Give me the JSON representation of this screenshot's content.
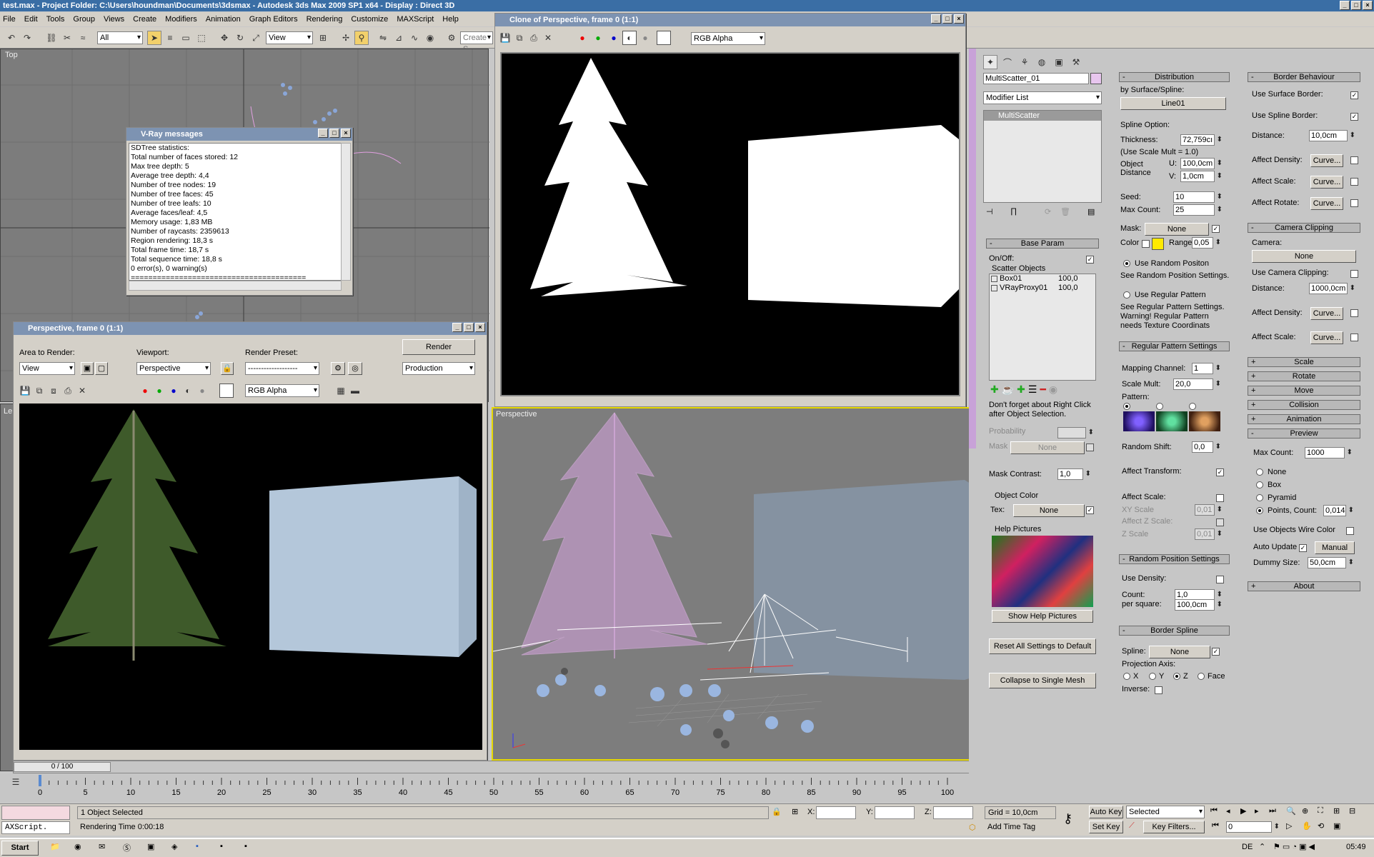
{
  "window": {
    "title": "test.max    - Project Folder: C:\\Users\\houndman\\Documents\\3dsmax    - Autodesk 3ds Max  2009 SP1  x64     - Display : Direct 3D"
  },
  "menu": [
    "File",
    "Edit",
    "Tools",
    "Group",
    "Views",
    "Create",
    "Modifiers",
    "Animation",
    "Graph Editors",
    "Rendering",
    "Customize",
    "MAXScript",
    "Help"
  ],
  "toolbar": {
    "selection_filter": "All",
    "ref_coord": "View",
    "create_sel": "Create S"
  },
  "top_viewport": {
    "label": "Top"
  },
  "vray_messages": {
    "title": "V-Ray messages",
    "lines": [
      "SDTree statistics:",
      "Total number of faces stored: 12",
      "Max tree depth: 5",
      "Average tree depth: 4,4",
      "Number of tree nodes: 19",
      "Number of tree faces: 45",
      "Number of tree leafs: 10",
      "Average faces/leaf: 4,5",
      "Memory usage: 1,83 MB",
      "Number of raycasts: 2359613",
      "Region rendering: 18,3 s",
      "Total frame time: 18,7 s",
      "Total sequence time: 18,8 s",
      "0 error(s), 0 warning(s)",
      "========================================"
    ]
  },
  "render_frame": {
    "title": "Perspective, frame 0 (1:1)",
    "area_label": "Area to Render:",
    "area_value": "View",
    "viewport_label": "Viewport:",
    "viewport_value": "Perspective",
    "preset_label": "Render Preset:",
    "preset_value": "-------------------",
    "render_btn": "Render",
    "production": "Production",
    "channel": "RGB Alpha"
  },
  "clone_frame": {
    "title": "Clone of Perspective, frame 0 (1:1)",
    "channel": "RGB Alpha"
  },
  "persp_viewport": {
    "label": "Perspective"
  },
  "left_viewport": {
    "label": "Le"
  },
  "cmd_panel": {
    "object_name": "MultiScatter_01",
    "modifier_list": "Modifier List",
    "stack_item": "MultiScatter",
    "base_param": "Base Param",
    "onoff": "On/Off:",
    "scatter_objects": "Scatter Objects",
    "scatter_list": [
      {
        "name": "Box01",
        "val": "100,0"
      },
      {
        "name": "VRayProxy01",
        "val": "100,0"
      }
    ],
    "hint": "Don't forget about Right Click after Object Selection.",
    "probability": "Probability",
    "mask": "Mask",
    "mask_none": "None",
    "mask_contrast": "Mask Contrast:",
    "mask_contrast_val": "1,0",
    "object_color": "Object Color",
    "tex": "Tex:",
    "tex_none": "None",
    "help_pictures": "Help Pictures",
    "show_help": "Show Help Pictures",
    "reset": "Reset All Settings to Default",
    "collapse": "Collapse to Single Mesh"
  },
  "distribution": {
    "title": "Distribution",
    "by_surface": "by Surface/Spline:",
    "line": "Line01",
    "spline_option": "Spline Option:",
    "thickness": "Thickness:",
    "thickness_val": "72,759cı",
    "use_scale": "(Use Scale Mult = 1.0)",
    "object_distance": "Object Distance",
    "u": "U:",
    "u_val": "100,0cm",
    "v": "V:",
    "v_val": "1,0cm",
    "seed": "Seed:",
    "seed_val": "10",
    "max_count": "Max Count:",
    "max_count_val": "25",
    "mask": "Mask:",
    "mask_val": "None",
    "color": "Color",
    "range": "Range",
    "range_val": "0,05",
    "use_random": "Use Random Positon",
    "see_random": "See Random Position Settings.",
    "use_regular": "Use Regular Pattern",
    "see_regular": "See Regular Pattern Settings. Warning! Regular Pattern needs Texture Coordinats",
    "regular_title": "Regular Pattern Settings",
    "mapping": "Mapping Channel:",
    "mapping_val": "1",
    "scale_mult": "Scale Mult:",
    "scale_mult_val": "20,0",
    "pattern": "Pattern:",
    "random_shift": "Random Shift:",
    "random_shift_val": "0,0",
    "affect_transform": "Affect Transform:",
    "affect_scale": "Affect Scale:",
    "xy_scale": "XY Scale",
    "xy_val": "0,01",
    "affect_z": "Affect Z Scale:",
    "z_scale": "Z Scale",
    "z_val": "0,01",
    "random_pos_title": "Random Position Settings",
    "use_density": "Use Density:",
    "count": "Count:",
    "count_val": "1,0",
    "per_square": "per square:",
    "per_square_val": "100,0cm",
    "border_spline": "Border Spline",
    "spline": "Spline:",
    "spline_val": "None",
    "proj_axis": "Projection Axis:",
    "x": "X",
    "y": "Y",
    "z": "Z",
    "face": "Face",
    "inverse": "Inverse:"
  },
  "border": {
    "title": "Border Behaviour",
    "use_surface": "Use Surface Border:",
    "use_spline": "Use Spline Border:",
    "distance": "Distance:",
    "distance_val": "10,0cm",
    "affect_density": "Affect Density:",
    "affect_scale": "Affect Scale:",
    "affect_rotate": "Affect Rotate:",
    "curve": "Curve...",
    "camera_clipping": "Camera Clipping",
    "camera": "Camera:",
    "camera_val": "None",
    "use_cam": "Use Camera Clipping:",
    "cam_distance": "Distance:",
    "cam_distance_val": "1000,0cm",
    "scale": "Scale",
    "rotate": "Rotate",
    "move": "Move",
    "collision": "Collision",
    "animation": "Animation",
    "preview": "Preview",
    "max_count": "Max Count:",
    "max_count_val": "1000",
    "none": "None",
    "box": "Box",
    "pyramid": "Pyramid",
    "points": "Points,  Count:",
    "points_val": "0,014",
    "wire_color": "Use Objects Wire Color",
    "auto_update": "Auto Update",
    "manual": "Manual",
    "dummy": "Dummy Size:",
    "dummy_val": "50,0cm",
    "about": "About"
  },
  "timeline": {
    "frame": "0 / 100",
    "ticks": [
      "0",
      "5",
      "10",
      "15",
      "20",
      "25",
      "30",
      "35",
      "40",
      "45",
      "50",
      "55",
      "60",
      "65",
      "70",
      "75",
      "80",
      "85",
      "90",
      "95",
      "100"
    ]
  },
  "status": {
    "listener": "AXScript.",
    "selected": "1 Object Selected",
    "render_time": "Rendering Time  0:00:18",
    "x": "X:",
    "y": "Y:",
    "z": "Z:",
    "grid": "Grid = 10,0cm",
    "add_tag": "Add Time Tag",
    "auto_key": "Auto Key",
    "set_key": "Set Key",
    "selected_dd": "Selected",
    "key_filters": "Key Filters...",
    "frame_val": "0"
  },
  "taskbar": {
    "start": "Start",
    "lang": "DE",
    "time": "05:49"
  }
}
